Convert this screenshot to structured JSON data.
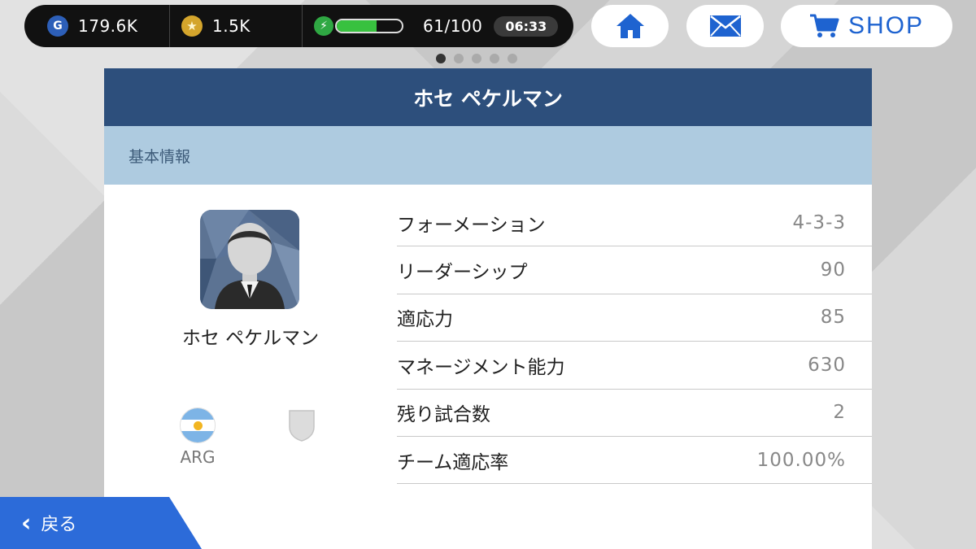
{
  "status": {
    "gp_icon": "G",
    "gp_value": "179.6K",
    "coins_value": "1.5K",
    "energy_text": "61/100",
    "energy_fraction": 0.61,
    "timer": "06:33"
  },
  "nav": {
    "home_icon": "home-icon",
    "mail_icon": "mail-icon",
    "shop_label": "SHOP"
  },
  "pager": {
    "count": 5,
    "active_index": 0
  },
  "panel": {
    "title": "ホセ ペケルマン",
    "section_title": "基本情報",
    "coach_name": "ホセ ペケルマン",
    "nation": "ARG"
  },
  "stats": [
    {
      "label": "フォーメーション",
      "value": "4-3-3"
    },
    {
      "label": "リーダーシップ",
      "value": "90"
    },
    {
      "label": "適応力",
      "value": "85"
    },
    {
      "label": "マネージメント能力",
      "value": "630"
    },
    {
      "label": "残り試合数",
      "value": "2"
    },
    {
      "label": "チーム適応率",
      "value": "100.00%"
    }
  ],
  "back": {
    "label": "戻る"
  },
  "colors": {
    "header_bg": "#2d4f7c",
    "section_bg": "#aecbe0",
    "accent_blue": "#1e63d0",
    "energy_green": "#38c13f"
  }
}
